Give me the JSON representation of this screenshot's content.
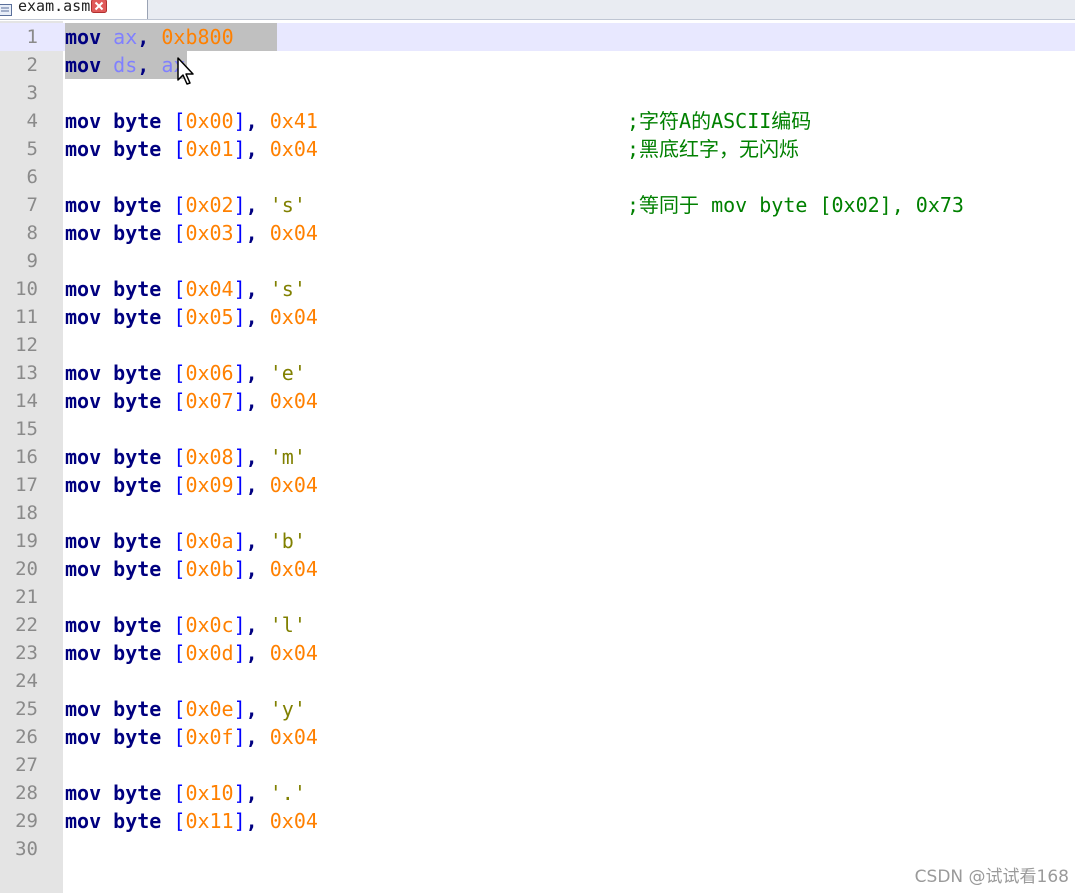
{
  "tab": {
    "title": "exam.asm",
    "file_icon": "file-icon",
    "close_icon": "close-icon"
  },
  "colors": {
    "keyword": "#000080",
    "register": "#8080ff",
    "number": "#ff8000",
    "bracket": "#0000ff",
    "string": "#808000",
    "comment": "#008000",
    "gutter": "#e4e4e4",
    "current_line": "#e8e8ff",
    "selection": "#c0c0c0"
  },
  "lines": [
    {
      "n": "1",
      "tokens": [
        [
          "kw",
          "mov"
        ],
        [
          "t",
          " "
        ],
        [
          "reg",
          "ax"
        ],
        [
          "punc",
          ","
        ],
        [
          "t",
          " "
        ],
        [
          "num",
          "0xb800"
        ]
      ],
      "comment": ""
    },
    {
      "n": "2",
      "tokens": [
        [
          "kw",
          "mov"
        ],
        [
          "t",
          " "
        ],
        [
          "reg",
          "ds"
        ],
        [
          "punc",
          ","
        ],
        [
          "t",
          " "
        ],
        [
          "reg",
          "ax"
        ]
      ],
      "comment": ""
    },
    {
      "n": "3",
      "tokens": [],
      "comment": ""
    },
    {
      "n": "4",
      "tokens": [
        [
          "kw",
          "mov"
        ],
        [
          "t",
          " "
        ],
        [
          "kw",
          "byte"
        ],
        [
          "t",
          " "
        ],
        [
          "br",
          "["
        ],
        [
          "num",
          "0x00"
        ],
        [
          "br",
          "]"
        ],
        [
          "punc",
          ","
        ],
        [
          "t",
          " "
        ],
        [
          "num",
          "0x41"
        ]
      ],
      "comment": ";字符A的ASCII编码"
    },
    {
      "n": "5",
      "tokens": [
        [
          "kw",
          "mov"
        ],
        [
          "t",
          " "
        ],
        [
          "kw",
          "byte"
        ],
        [
          "t",
          " "
        ],
        [
          "br",
          "["
        ],
        [
          "num",
          "0x01"
        ],
        [
          "br",
          "]"
        ],
        [
          "punc",
          ","
        ],
        [
          "t",
          " "
        ],
        [
          "num",
          "0x04"
        ]
      ],
      "comment": ";黑底红字，无闪烁"
    },
    {
      "n": "6",
      "tokens": [],
      "comment": ""
    },
    {
      "n": "7",
      "tokens": [
        [
          "kw",
          "mov"
        ],
        [
          "t",
          " "
        ],
        [
          "kw",
          "byte"
        ],
        [
          "t",
          " "
        ],
        [
          "br",
          "["
        ],
        [
          "num",
          "0x02"
        ],
        [
          "br",
          "]"
        ],
        [
          "punc",
          ","
        ],
        [
          "t",
          " "
        ],
        [
          "str",
          "'s'"
        ]
      ],
      "comment": ";等同于 mov byte [0x02], 0x73"
    },
    {
      "n": "8",
      "tokens": [
        [
          "kw",
          "mov"
        ],
        [
          "t",
          " "
        ],
        [
          "kw",
          "byte"
        ],
        [
          "t",
          " "
        ],
        [
          "br",
          "["
        ],
        [
          "num",
          "0x03"
        ],
        [
          "br",
          "]"
        ],
        [
          "punc",
          ","
        ],
        [
          "t",
          " "
        ],
        [
          "num",
          "0x04"
        ]
      ],
      "comment": ""
    },
    {
      "n": "9",
      "tokens": [],
      "comment": ""
    },
    {
      "n": "10",
      "tokens": [
        [
          "kw",
          "mov"
        ],
        [
          "t",
          " "
        ],
        [
          "kw",
          "byte"
        ],
        [
          "t",
          " "
        ],
        [
          "br",
          "["
        ],
        [
          "num",
          "0x04"
        ],
        [
          "br",
          "]"
        ],
        [
          "punc",
          ","
        ],
        [
          "t",
          " "
        ],
        [
          "str",
          "'s'"
        ]
      ],
      "comment": ""
    },
    {
      "n": "11",
      "tokens": [
        [
          "kw",
          "mov"
        ],
        [
          "t",
          " "
        ],
        [
          "kw",
          "byte"
        ],
        [
          "t",
          " "
        ],
        [
          "br",
          "["
        ],
        [
          "num",
          "0x05"
        ],
        [
          "br",
          "]"
        ],
        [
          "punc",
          ","
        ],
        [
          "t",
          " "
        ],
        [
          "num",
          "0x04"
        ]
      ],
      "comment": ""
    },
    {
      "n": "12",
      "tokens": [],
      "comment": ""
    },
    {
      "n": "13",
      "tokens": [
        [
          "kw",
          "mov"
        ],
        [
          "t",
          " "
        ],
        [
          "kw",
          "byte"
        ],
        [
          "t",
          " "
        ],
        [
          "br",
          "["
        ],
        [
          "num",
          "0x06"
        ],
        [
          "br",
          "]"
        ],
        [
          "punc",
          ","
        ],
        [
          "t",
          " "
        ],
        [
          "str",
          "'e'"
        ]
      ],
      "comment": ""
    },
    {
      "n": "14",
      "tokens": [
        [
          "kw",
          "mov"
        ],
        [
          "t",
          " "
        ],
        [
          "kw",
          "byte"
        ],
        [
          "t",
          " "
        ],
        [
          "br",
          "["
        ],
        [
          "num",
          "0x07"
        ],
        [
          "br",
          "]"
        ],
        [
          "punc",
          ","
        ],
        [
          "t",
          " "
        ],
        [
          "num",
          "0x04"
        ]
      ],
      "comment": ""
    },
    {
      "n": "15",
      "tokens": [],
      "comment": ""
    },
    {
      "n": "16",
      "tokens": [
        [
          "kw",
          "mov"
        ],
        [
          "t",
          " "
        ],
        [
          "kw",
          "byte"
        ],
        [
          "t",
          " "
        ],
        [
          "br",
          "["
        ],
        [
          "num",
          "0x08"
        ],
        [
          "br",
          "]"
        ],
        [
          "punc",
          ","
        ],
        [
          "t",
          " "
        ],
        [
          "str",
          "'m'"
        ]
      ],
      "comment": ""
    },
    {
      "n": "17",
      "tokens": [
        [
          "kw",
          "mov"
        ],
        [
          "t",
          " "
        ],
        [
          "kw",
          "byte"
        ],
        [
          "t",
          " "
        ],
        [
          "br",
          "["
        ],
        [
          "num",
          "0x09"
        ],
        [
          "br",
          "]"
        ],
        [
          "punc",
          ","
        ],
        [
          "t",
          " "
        ],
        [
          "num",
          "0x04"
        ]
      ],
      "comment": ""
    },
    {
      "n": "18",
      "tokens": [],
      "comment": ""
    },
    {
      "n": "19",
      "tokens": [
        [
          "kw",
          "mov"
        ],
        [
          "t",
          " "
        ],
        [
          "kw",
          "byte"
        ],
        [
          "t",
          " "
        ],
        [
          "br",
          "["
        ],
        [
          "num",
          "0x0a"
        ],
        [
          "br",
          "]"
        ],
        [
          "punc",
          ","
        ],
        [
          "t",
          " "
        ],
        [
          "str",
          "'b'"
        ]
      ],
      "comment": ""
    },
    {
      "n": "20",
      "tokens": [
        [
          "kw",
          "mov"
        ],
        [
          "t",
          " "
        ],
        [
          "kw",
          "byte"
        ],
        [
          "t",
          " "
        ],
        [
          "br",
          "["
        ],
        [
          "num",
          "0x0b"
        ],
        [
          "br",
          "]"
        ],
        [
          "punc",
          ","
        ],
        [
          "t",
          " "
        ],
        [
          "num",
          "0x04"
        ]
      ],
      "comment": ""
    },
    {
      "n": "21",
      "tokens": [],
      "comment": ""
    },
    {
      "n": "22",
      "tokens": [
        [
          "kw",
          "mov"
        ],
        [
          "t",
          " "
        ],
        [
          "kw",
          "byte"
        ],
        [
          "t",
          " "
        ],
        [
          "br",
          "["
        ],
        [
          "num",
          "0x0c"
        ],
        [
          "br",
          "]"
        ],
        [
          "punc",
          ","
        ],
        [
          "t",
          " "
        ],
        [
          "str",
          "'l'"
        ]
      ],
      "comment": ""
    },
    {
      "n": "23",
      "tokens": [
        [
          "kw",
          "mov"
        ],
        [
          "t",
          " "
        ],
        [
          "kw",
          "byte"
        ],
        [
          "t",
          " "
        ],
        [
          "br",
          "["
        ],
        [
          "num",
          "0x0d"
        ],
        [
          "br",
          "]"
        ],
        [
          "punc",
          ","
        ],
        [
          "t",
          " "
        ],
        [
          "num",
          "0x04"
        ]
      ],
      "comment": ""
    },
    {
      "n": "24",
      "tokens": [],
      "comment": ""
    },
    {
      "n": "25",
      "tokens": [
        [
          "kw",
          "mov"
        ],
        [
          "t",
          " "
        ],
        [
          "kw",
          "byte"
        ],
        [
          "t",
          " "
        ],
        [
          "br",
          "["
        ],
        [
          "num",
          "0x0e"
        ],
        [
          "br",
          "]"
        ],
        [
          "punc",
          ","
        ],
        [
          "t",
          " "
        ],
        [
          "str",
          "'y'"
        ]
      ],
      "comment": ""
    },
    {
      "n": "26",
      "tokens": [
        [
          "kw",
          "mov"
        ],
        [
          "t",
          " "
        ],
        [
          "kw",
          "byte"
        ],
        [
          "t",
          " "
        ],
        [
          "br",
          "["
        ],
        [
          "num",
          "0x0f"
        ],
        [
          "br",
          "]"
        ],
        [
          "punc",
          ","
        ],
        [
          "t",
          " "
        ],
        [
          "num",
          "0x04"
        ]
      ],
      "comment": ""
    },
    {
      "n": "27",
      "tokens": [],
      "comment": ""
    },
    {
      "n": "28",
      "tokens": [
        [
          "kw",
          "mov"
        ],
        [
          "t",
          " "
        ],
        [
          "kw",
          "byte"
        ],
        [
          "t",
          " "
        ],
        [
          "br",
          "["
        ],
        [
          "num",
          "0x10"
        ],
        [
          "br",
          "]"
        ],
        [
          "punc",
          ","
        ],
        [
          "t",
          " "
        ],
        [
          "str",
          "'.'"
        ]
      ],
      "comment": ""
    },
    {
      "n": "29",
      "tokens": [
        [
          "kw",
          "mov"
        ],
        [
          "t",
          " "
        ],
        [
          "kw",
          "byte"
        ],
        [
          "t",
          " "
        ],
        [
          "br",
          "["
        ],
        [
          "num",
          "0x11"
        ],
        [
          "br",
          "]"
        ],
        [
          "punc",
          ","
        ],
        [
          "t",
          " "
        ],
        [
          "num",
          "0x04"
        ]
      ],
      "comment": ""
    },
    {
      "n": "30",
      "tokens": [],
      "comment": ""
    }
  ],
  "current_line": "1",
  "selected_lines": [
    "1",
    "2"
  ],
  "cursor_icon": "mouse-pointer-icon",
  "watermark": "CSDN @试试看168"
}
